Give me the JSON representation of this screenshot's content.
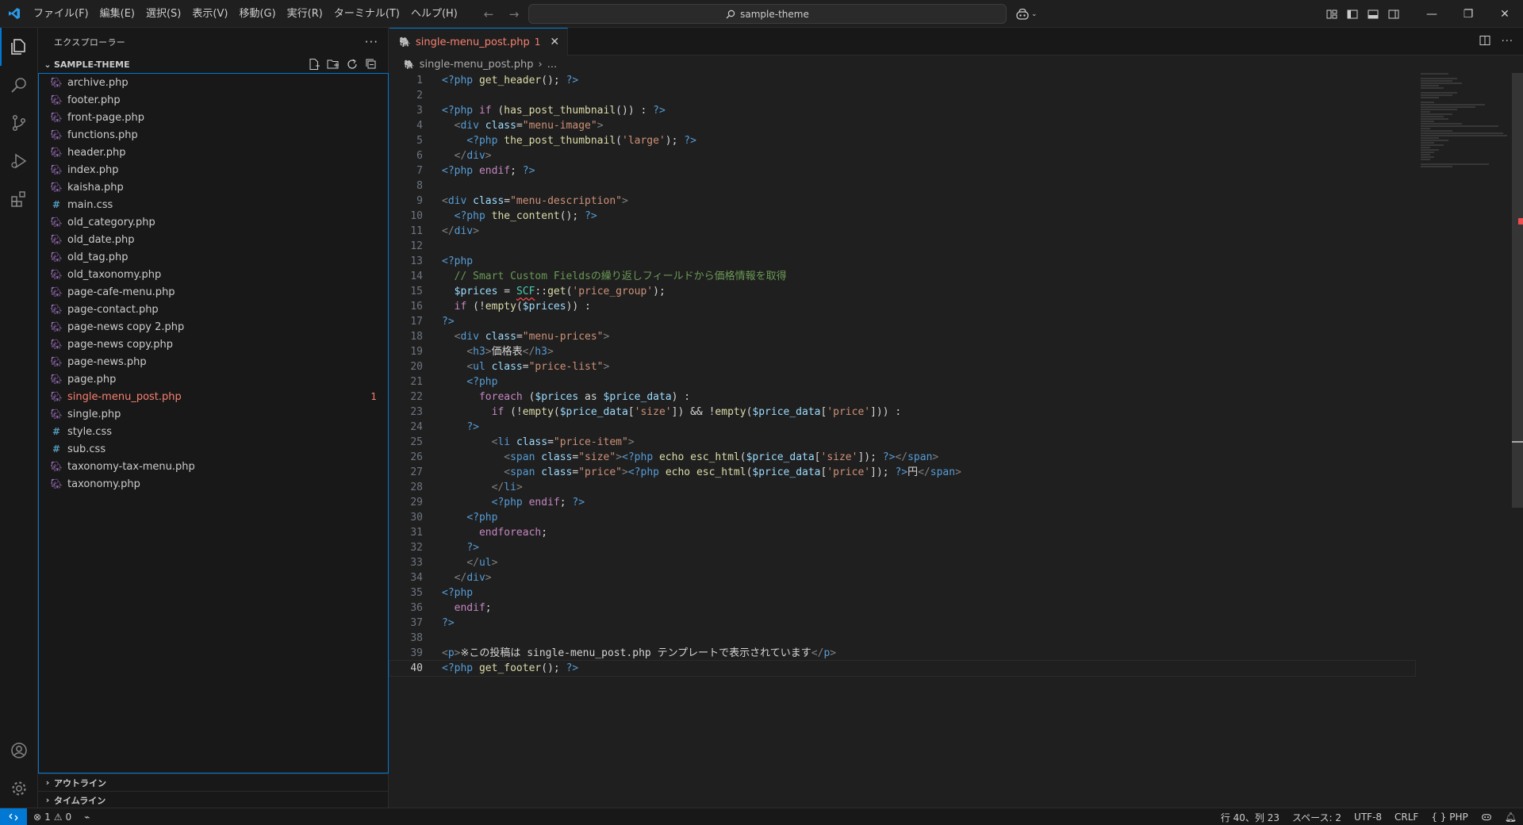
{
  "menubar": {
    "items": [
      "ファイル(F)",
      "編集(E)",
      "選択(S)",
      "表示(V)",
      "移動(G)",
      "実行(R)",
      "ターミナル(T)",
      "ヘルプ(H)"
    ]
  },
  "command_center": {
    "label": "sample-theme"
  },
  "sidebar": {
    "title": "エクスプローラー",
    "folder": "SAMPLE-THEME",
    "files": [
      {
        "name": "archive.php",
        "type": "php"
      },
      {
        "name": "footer.php",
        "type": "php"
      },
      {
        "name": "front-page.php",
        "type": "php"
      },
      {
        "name": "functions.php",
        "type": "php"
      },
      {
        "name": "header.php",
        "type": "php"
      },
      {
        "name": "index.php",
        "type": "php"
      },
      {
        "name": "kaisha.php",
        "type": "php"
      },
      {
        "name": "main.css",
        "type": "css"
      },
      {
        "name": "old_category.php",
        "type": "php"
      },
      {
        "name": "old_date.php",
        "type": "php"
      },
      {
        "name": "old_tag.php",
        "type": "php"
      },
      {
        "name": "old_taxonomy.php",
        "type": "php"
      },
      {
        "name": "page-cafe-menu.php",
        "type": "php"
      },
      {
        "name": "page-contact.php",
        "type": "php"
      },
      {
        "name": "page-news copy 2.php",
        "type": "php"
      },
      {
        "name": "page-news copy.php",
        "type": "php"
      },
      {
        "name": "page-news.php",
        "type": "php"
      },
      {
        "name": "page.php",
        "type": "php"
      },
      {
        "name": "single-menu_post.php",
        "type": "php",
        "error": true,
        "badge": "1"
      },
      {
        "name": "single.php",
        "type": "php"
      },
      {
        "name": "style.css",
        "type": "css"
      },
      {
        "name": "sub.css",
        "type": "css"
      },
      {
        "name": "taxonomy-tax-menu.php",
        "type": "php"
      },
      {
        "name": "taxonomy.php",
        "type": "php"
      }
    ],
    "outline_label": "アウトライン",
    "timeline_label": "タイムライン"
  },
  "editor": {
    "tab": {
      "name": "single-menu_post.php",
      "problems": "1"
    },
    "breadcrumb": {
      "file": "single-menu_post.php",
      "rest": "..."
    },
    "current_line": 40
  },
  "statusbar": {
    "errors": "1",
    "warnings": "0",
    "position": "行 40、列 23",
    "spaces": "スペース: 2",
    "encoding": "UTF-8",
    "eol": "CRLF",
    "language": "PHP"
  },
  "colors": {
    "accent": "#0078d4",
    "error": "#f88070",
    "php_icon": "#a074c4",
    "css_icon": "#519aba"
  }
}
